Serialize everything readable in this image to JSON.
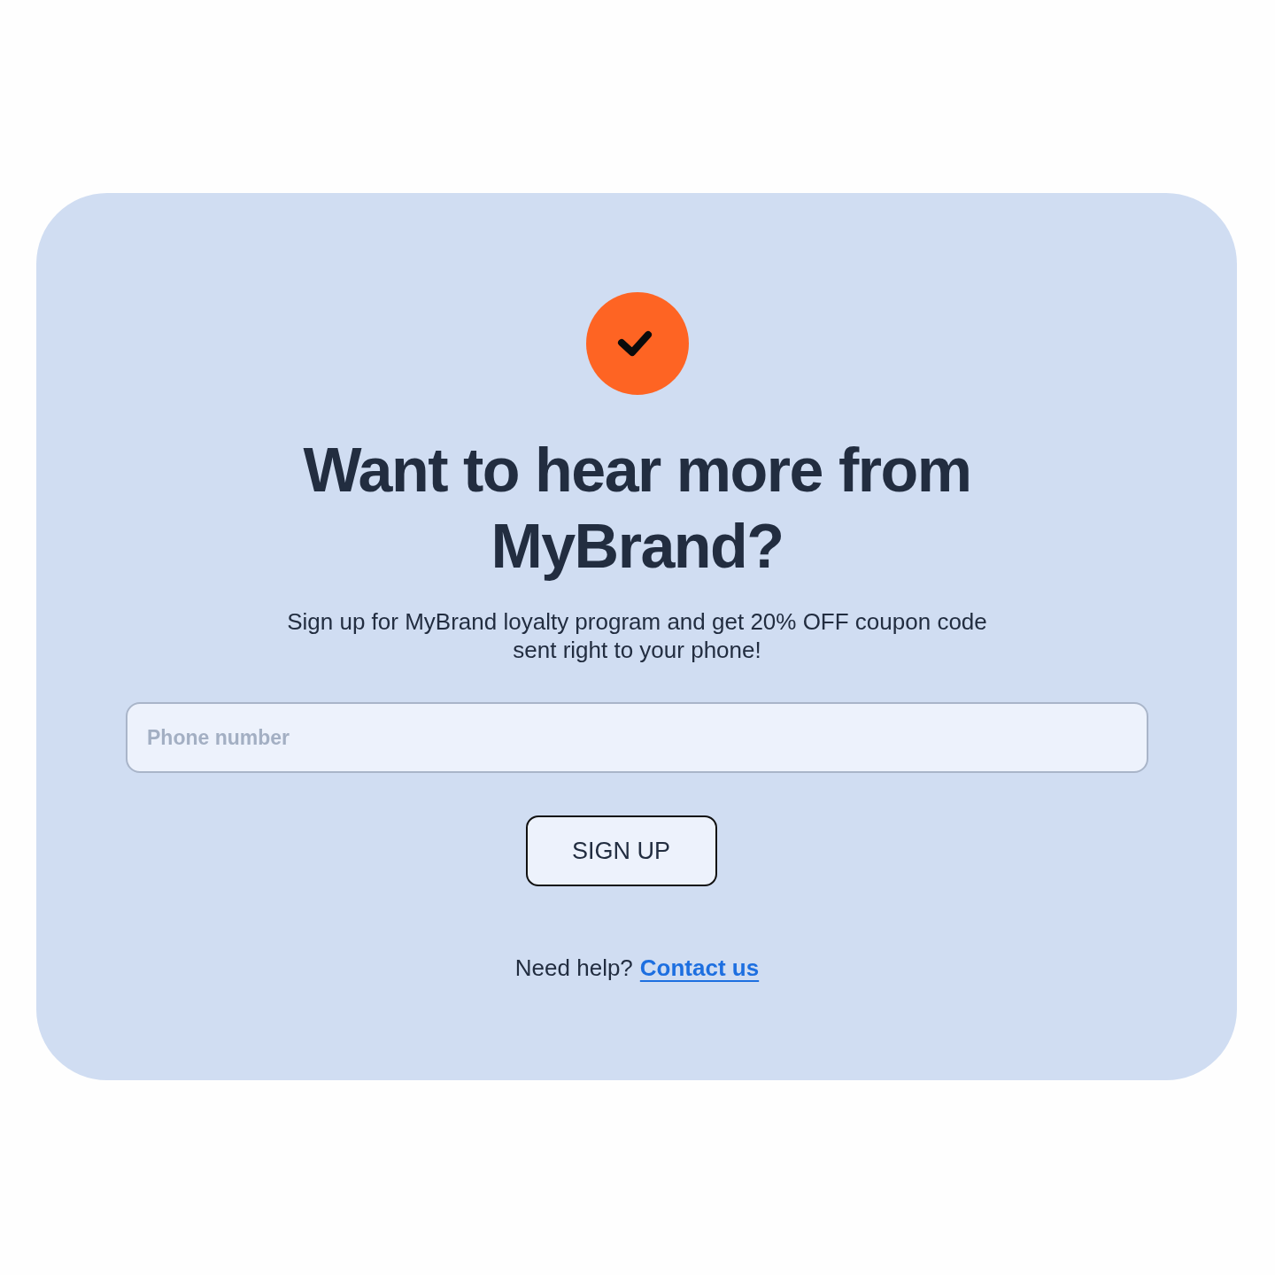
{
  "heading": "Want to hear more from MyBrand?",
  "description": "Sign up for MyBrand loyalty program and get 20% OFF coupon code sent right to your phone!",
  "phone_field": {
    "placeholder": "Phone number"
  },
  "signup_button": {
    "label": "SIGN UP"
  },
  "help": {
    "text": "Need help?",
    "link": "Contact us"
  }
}
